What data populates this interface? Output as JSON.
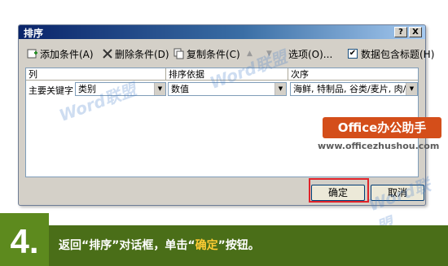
{
  "dialog": {
    "title": "排序",
    "help_btn": "?",
    "close_btn": "X"
  },
  "toolbar": {
    "add_level": "添加条件(A)",
    "delete_level": "删除条件(D)",
    "copy_level": "复制条件(C)",
    "move_up": "▲",
    "move_down": "▼",
    "options": "选项(O)...",
    "has_headers": "数据包含标题(H)",
    "has_headers_checked": "✔"
  },
  "grid": {
    "headers": [
      "列",
      "排序依据",
      "次序"
    ],
    "rows": [
      {
        "label": "主要关键字",
        "column": "类别",
        "sort_on": "数值",
        "order": "海鲜, 特制品, 谷类/麦片, 肉/家禽"
      }
    ]
  },
  "buttons": {
    "ok": "确定",
    "cancel": "取消"
  },
  "brand": {
    "name": "Office办公助手",
    "url": "www.officezhushou.com",
    "watermark": "Word联盟"
  },
  "banner": {
    "step": "4.",
    "text_before": "返回“排序”对话框，单击“",
    "text_highlight": "确定",
    "text_after": "”按钮。"
  },
  "colors": {
    "banner": "#4a6e18",
    "highlight_box": "#e0232b",
    "brand_badge": "#d44e1a"
  }
}
